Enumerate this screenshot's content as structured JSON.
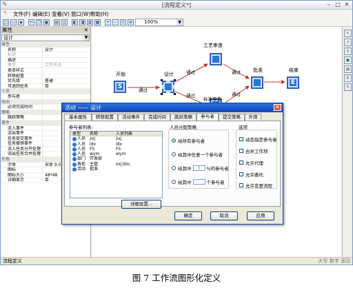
{
  "window": {
    "title": "[流程定义*]"
  },
  "menu": [
    "文件(F)",
    "编辑(E)",
    "查看(V)",
    "窗口(W)",
    "帮助(H)"
  ],
  "toolbar": {
    "zoom": "100%"
  },
  "props": {
    "header": "属性",
    "object": "设计",
    "rows": [
      {
        "k": "属性",
        "v": "",
        "cat": true
      },
      {
        "k": "名称",
        "v": "设计"
      },
      {
        "k": "标识",
        "v": "",
        "dim": true
      },
      {
        "k": "描述",
        "v": ""
      },
      {
        "k": "类型",
        "v": "工作节点",
        "dim": true
      },
      {
        "k": "表单样式",
        "v": ""
      },
      {
        "k": "转移配置",
        "v": ""
      },
      {
        "k": "优先级",
        "v": "普通"
      },
      {
        "k": "可退回任务",
        "v": "否"
      },
      {
        "k": "人员",
        "v": "",
        "cat": true
      },
      {
        "k": "参与者",
        "v": ""
      },
      {
        "k": "时间",
        "v": "",
        "cat": true
      },
      {
        "k": "必须完成时间",
        "v": ""
      },
      {
        "k": "策略",
        "v": "",
        "cat": true
      },
      {
        "k": "跳跃策略",
        "v": ""
      },
      {
        "k": "事件",
        "v": "",
        "cat": true
      },
      {
        "k": "流入事件",
        "v": ""
      },
      {
        "k": "流出事件",
        "v": ""
      },
      {
        "k": "任务提交事件",
        "v": ""
      },
      {
        "k": "任务撤销事件",
        "v": ""
      },
      {
        "k": "流入任务分开处理",
        "v": ""
      },
      {
        "k": "流出任务合并处理",
        "v": ""
      },
      {
        "k": "外观",
        "v": "",
        "cat": true
      },
      {
        "k": "字体",
        "v": "宋体 9.0"
      },
      {
        "k": "图标",
        "v": ""
      },
      {
        "k": "图标大小",
        "v": "48*48"
      },
      {
        "k": "详细显示",
        "v": "否"
      }
    ]
  },
  "flow": {
    "nodes": {
      "start": "开始",
      "design": "设计",
      "review": "工艺审查",
      "approve": "批准",
      "end": "结束"
    },
    "edges": {
      "e1": "通过",
      "e2": "通过",
      "e3": "通过",
      "e4": "通过",
      "e5": "通过",
      "e6": "标准审查"
    }
  },
  "dialog": {
    "title": "活动 —— 设计",
    "tabs": [
      "基本属性",
      "转移配置",
      "活动事件",
      "完成时间",
      "跳跃策略",
      "参与者",
      "提交策略",
      "外观"
    ],
    "list_label": "参与者列表:",
    "columns": [
      "类型",
      "名称",
      "人员列表"
    ],
    "participants": [
      {
        "type": "人员",
        "name": "zxj",
        "list": "zxj"
      },
      {
        "type": "人员",
        "name": "ldx",
        "list": "ldx"
      },
      {
        "type": "人员",
        "name": "FS",
        "list": "FS"
      },
      {
        "type": "人员",
        "name": "wym",
        "list": "wym"
      },
      {
        "type": "部门",
        "name": "开发部",
        "list": ""
      },
      {
        "type": "角色",
        "name": "主管",
        "list": "zxj;ldx;"
      },
      {
        "type": "活动",
        "name": "批准",
        "list": ""
      }
    ],
    "detail_button": "详细设置...",
    "strategy_label": "人员分配策略",
    "strategy": {
      "all": "给所有参与者",
      "any_pre": "给其中任意一个参与者",
      "pct_pre": "给其中",
      "pct_val": "0",
      "pct_post": "%的参与者",
      "n_pre": "给其中",
      "n_val": "",
      "n_post": "个参与者"
    },
    "options_label": "选项",
    "options": [
      "动态指定参与者",
      "合并工作项",
      "允许代理",
      "允许委托",
      "允许变更流程"
    ],
    "ok": "确定",
    "cancel": "取消",
    "apply": "应用"
  },
  "status": {
    "left": "流程定义",
    "right": "大写  数字  滚动"
  },
  "caption": "图 7  工作流图形化定义"
}
